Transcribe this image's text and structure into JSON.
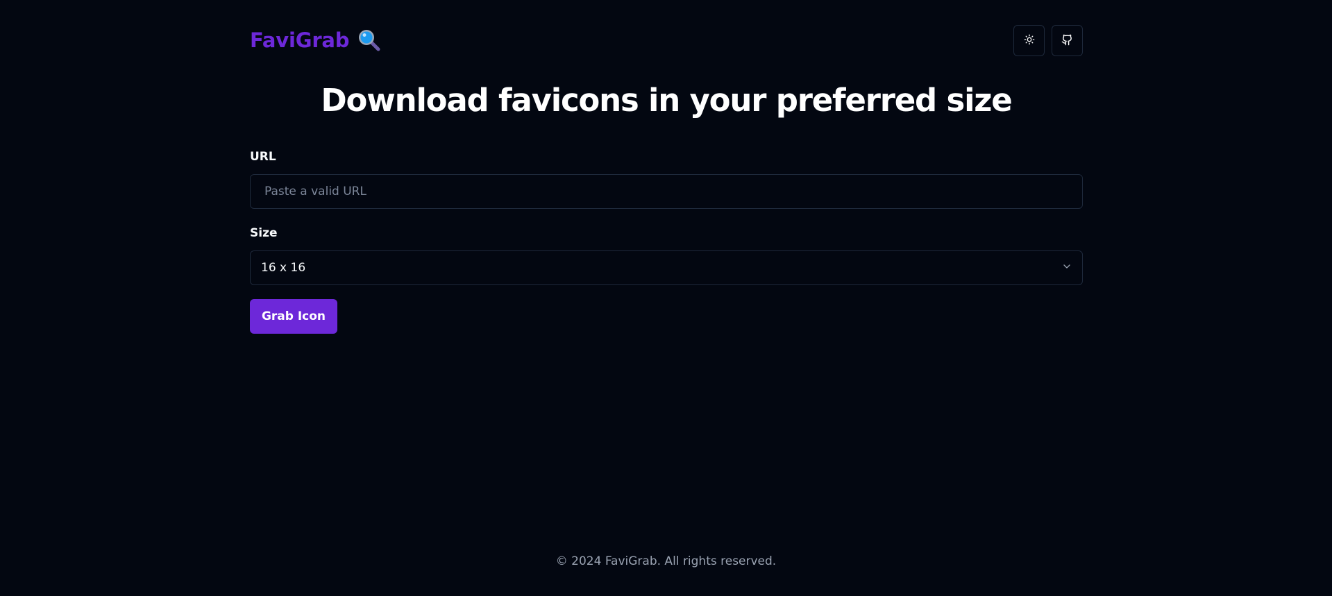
{
  "header": {
    "brand_name": "FaviGrab",
    "brand_icon": "magnifying-glass-icon",
    "theme_toggle_icon": "sun-icon",
    "github_icon": "github-icon"
  },
  "main": {
    "headline": "Download favicons in your preferred size",
    "url_label": "URL",
    "url_value": "",
    "url_placeholder": "Paste a valid URL",
    "size_label": "Size",
    "size_selected": "16 x 16",
    "size_dropdown_icon": "chevron-down-icon",
    "submit_label": "Grab Icon"
  },
  "footer": {
    "copyright": "© 2024 FaviGrab. All rights reserved."
  },
  "colors": {
    "background": "#030711",
    "accent": "#6d28d9",
    "border": "#1e293b",
    "muted_text": "#9aa3b2"
  }
}
